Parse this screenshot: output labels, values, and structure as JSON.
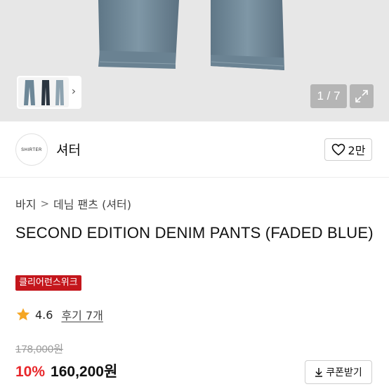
{
  "gallery": {
    "counter": "1 / 7",
    "current": 1,
    "total": 7,
    "expand_icon": "expand-icon",
    "next_icon": "chevron-right-icon"
  },
  "brand": {
    "logo_text": "SHIRTER",
    "name": "셔터",
    "like_icon": "heart-outline-icon",
    "like_count": "2만"
  },
  "breadcrumb": {
    "items": [
      "바지",
      "데님 팬츠 (셔터)"
    ],
    "separator_icon": "chevron-right-icon"
  },
  "product": {
    "title": "SECOND EDITION DENIM PANTS (FADED BLUE)",
    "badge": "클리어런스위크",
    "badge_color": "#c4161c",
    "rating": "4.6",
    "rating_icon": "star-icon",
    "reviews_label": "후기 7개",
    "original_price": "178,000원",
    "discount": "10%",
    "discount_color": "#e8262a",
    "price": "160,200원",
    "coupon_label": "쿠폰받기",
    "coupon_icon": "download-icon"
  }
}
